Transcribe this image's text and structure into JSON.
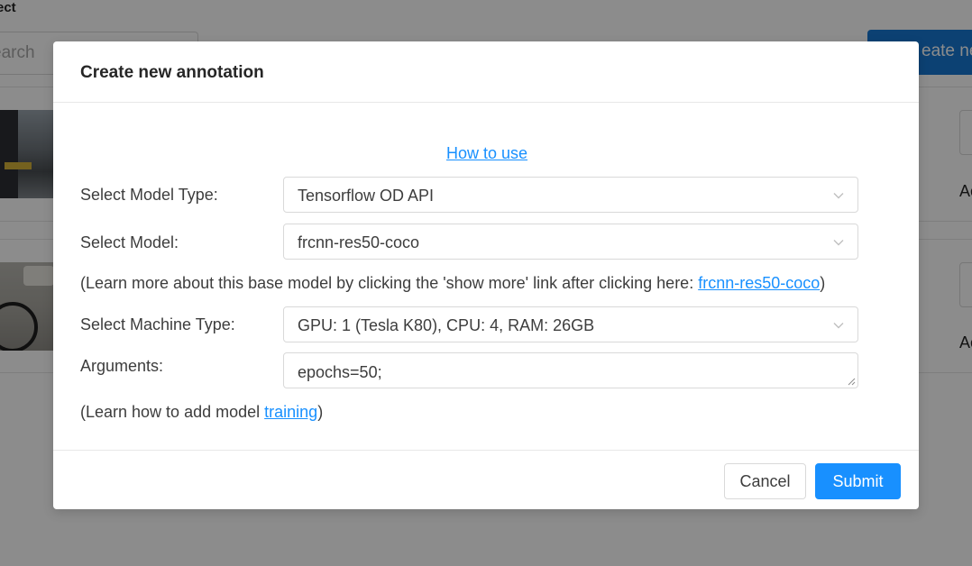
{
  "background": {
    "title": "ect",
    "search_placeholder": "earch",
    "create_button_label": "eate ne",
    "row_action_text": "Ac"
  },
  "modal": {
    "title": "Create new annotation",
    "how_to_link": "How to use",
    "model_type": {
      "label": "Select Model Type:",
      "value": "Tensorflow OD API"
    },
    "model": {
      "label": "Select Model:",
      "value": "frcnn-res50-coco"
    },
    "learn_more": {
      "prefix": "(Learn more about this base model by clicking the 'show more' link after clicking here: ",
      "link": "frcnn-res50-coco",
      "suffix": ")"
    },
    "machine_type": {
      "label": "Select Machine Type:",
      "value": "GPU: 1 (Tesla K80), CPU: 4, RAM: 26GB"
    },
    "arguments": {
      "label": "Arguments:",
      "value": "epochs=50;"
    },
    "training_note": {
      "prefix": "(Learn how to add model ",
      "link": "training",
      "suffix": ")"
    },
    "cancel_label": "Cancel",
    "submit_label": "Submit"
  },
  "colors": {
    "primary": "#1890ff",
    "link": "#1890ff",
    "overlay": "rgba(0,0,0,0.45)"
  },
  "icons": [
    "chevron-down-icon",
    "resize-grip-icon"
  ]
}
